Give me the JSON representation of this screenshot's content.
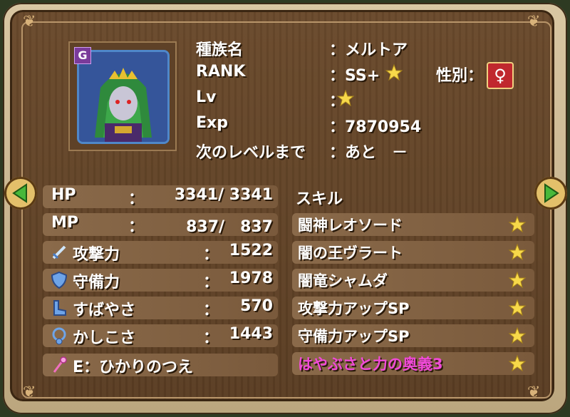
{
  "profile": {
    "species_label": "種族名",
    "species_value": "：メルトア",
    "rank_label": "RANK",
    "rank_value": "：SS+",
    "gender_label": "性別：",
    "gender_symbol": "♀",
    "lv_label": "Lv",
    "lv_value": "：",
    "exp_label": "Exp",
    "exp_value": "：7870954",
    "next_label": "次のレベルまで",
    "next_value": "：あと　－",
    "portrait_badge": "G"
  },
  "stats": [
    {
      "label": "HP",
      "sep": "：",
      "value": "3341/ 3341",
      "icon": ""
    },
    {
      "label": "MP",
      "sep": "：",
      "value": "837/　837",
      "icon": ""
    },
    {
      "label": "攻撃力",
      "sep": "：",
      "value": "1522",
      "icon": "sword-icon"
    },
    {
      "label": "守備力",
      "sep": "：",
      "value": "1978",
      "icon": "shield-icon"
    },
    {
      "label": "すばやさ",
      "sep": "：",
      "value": "570",
      "icon": "boot-icon"
    },
    {
      "label": "かしこさ",
      "sep": "：",
      "value": "1443",
      "icon": "necklace-icon"
    }
  ],
  "equipment": {
    "label": "E：ひかりのつえ",
    "icon": "staff-icon"
  },
  "skills": {
    "header": "スキル",
    "items": [
      {
        "name": "闘神レオソード",
        "color": "#ffffff"
      },
      {
        "name": "闇の王ヴラート",
        "color": "#ffffff"
      },
      {
        "name": "闇竜シャムダ",
        "color": "#ffffff"
      },
      {
        "name": "攻撃力アップSP",
        "color": "#ffffff"
      },
      {
        "name": "守備力アップSP",
        "color": "#ffffff"
      },
      {
        "name": "はやぶさと力の奥義3",
        "color": "#f04ad8"
      }
    ]
  },
  "colors": {
    "accent_star": "#f7d94a",
    "gender_badge": "#c0282e",
    "nav_arrow": "#48b83a"
  }
}
